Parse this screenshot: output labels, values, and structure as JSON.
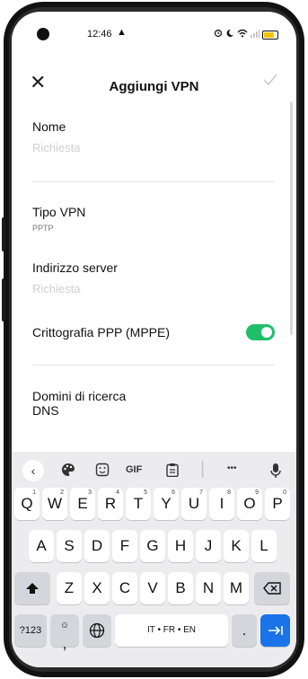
{
  "status_bar": {
    "time": "12:46",
    "alert_glyph": "▲"
  },
  "app_bar": {
    "title": "Aggiungi VPN",
    "close_glyph": "✕"
  },
  "form": {
    "name": {
      "label": "Nome",
      "placeholder": "Richiesta"
    },
    "vpn_type": {
      "label": "Tipo VPN",
      "value": "PPTP"
    },
    "server": {
      "label": "Indirizzo server",
      "placeholder": "Richiesta"
    },
    "encryption": {
      "label": "Crittografia PPP (MPPE)",
      "enabled": true
    },
    "dns": {
      "label_line1": "Domini di ricerca",
      "label_line2": "DNS"
    }
  },
  "keyboard": {
    "toolbar": {
      "back": "‹",
      "gif": "GIF",
      "more": "•••"
    },
    "row1": [
      {
        "k": "Q",
        "s": "1"
      },
      {
        "k": "W",
        "s": "2"
      },
      {
        "k": "E",
        "s": "3"
      },
      {
        "k": "R",
        "s": "4"
      },
      {
        "k": "T",
        "s": "5"
      },
      {
        "k": "Y",
        "s": "6"
      },
      {
        "k": "U",
        "s": "7"
      },
      {
        "k": "I",
        "s": "8"
      },
      {
        "k": "O",
        "s": "9"
      },
      {
        "k": "P",
        "s": "0"
      }
    ],
    "row2": [
      "A",
      "S",
      "D",
      "F",
      "G",
      "H",
      "J",
      "K",
      "L"
    ],
    "row3": [
      "Z",
      "X",
      "C",
      "V",
      "B",
      "N",
      "M"
    ],
    "bottom": {
      "symbols": "?123",
      "comma": ",",
      "space": "IT • FR • EN",
      "period": "."
    },
    "accent_color": "#1a73e8",
    "toggle_color": "#1fbf6a"
  }
}
